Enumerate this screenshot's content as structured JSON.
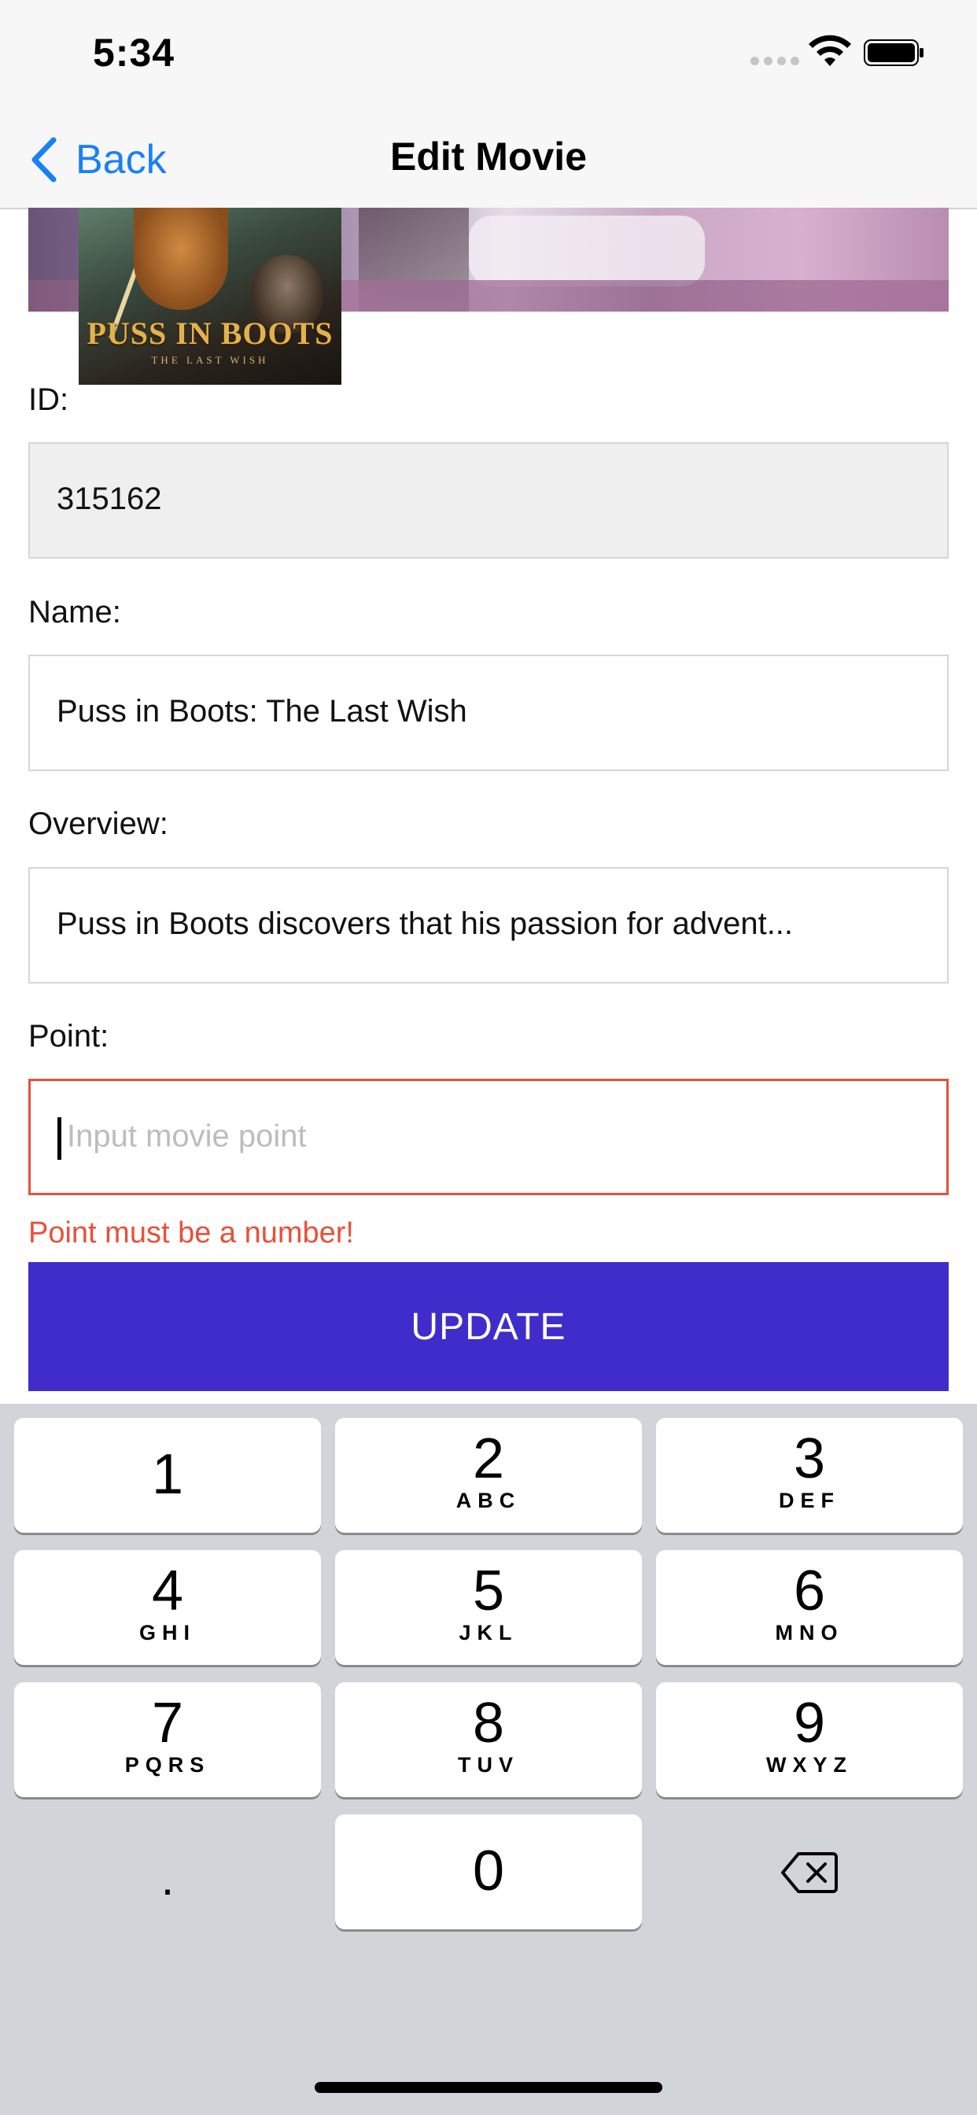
{
  "status_bar": {
    "time": "5:34",
    "icons": [
      "signal-dots-icon",
      "wifi-icon",
      "battery-icon"
    ]
  },
  "nav": {
    "back_label": "Back",
    "title": "Edit Movie",
    "accent_color": "#1a80f3"
  },
  "poster": {
    "title": "PUSS IN BOOTS",
    "subtitle": "THE LAST WISH"
  },
  "form": {
    "id_label": "ID:",
    "id_value": "315162",
    "name_label": "Name:",
    "name_value": "Puss in Boots: The Last Wish",
    "overview_label": "Overview:",
    "overview_value": "Puss in Boots discovers that his passion for advent...",
    "point_label": "Point:",
    "point_value": "",
    "point_placeholder": "Input movie point",
    "error_message": "Point must be a number!",
    "error_color": "#e8503b",
    "update_label": "UPDATE",
    "update_color": "#3f2dcb"
  },
  "keyboard": {
    "keys": [
      {
        "digit": "1",
        "letters": ""
      },
      {
        "digit": "2",
        "letters": "ABC"
      },
      {
        "digit": "3",
        "letters": "DEF"
      },
      {
        "digit": "4",
        "letters": "GHI"
      },
      {
        "digit": "5",
        "letters": "JKL"
      },
      {
        "digit": "6",
        "letters": "MNO"
      },
      {
        "digit": "7",
        "letters": "PQRS"
      },
      {
        "digit": "8",
        "letters": "TUV"
      },
      {
        "digit": "9",
        "letters": "WXYZ"
      },
      {
        "digit": "0",
        "letters": ""
      }
    ],
    "dot": ".",
    "delete_icon": "delete-backspace-icon"
  }
}
